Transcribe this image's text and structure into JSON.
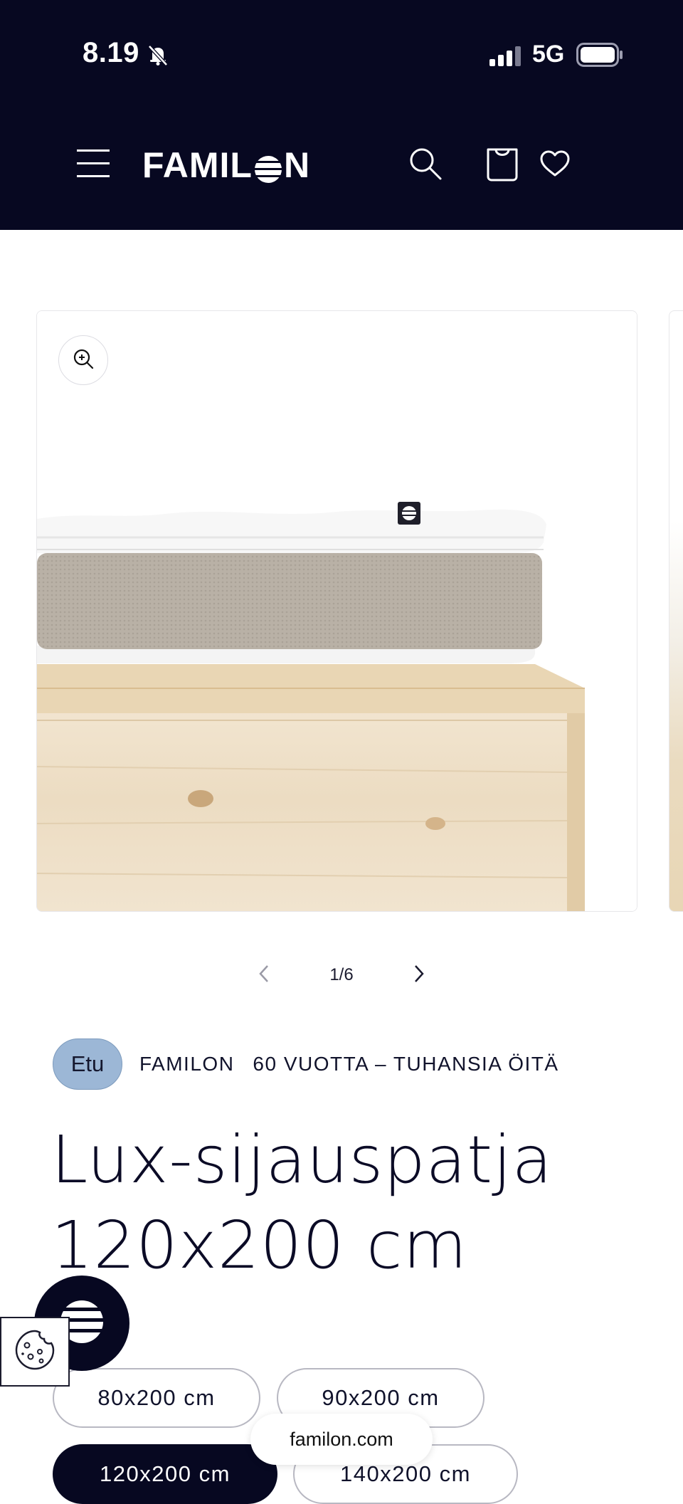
{
  "status_bar": {
    "time": "8.19",
    "network": "5G"
  },
  "header": {
    "logo_text_left": "FAMIL",
    "logo_text_right": "N",
    "icons": [
      "menu-icon",
      "search-icon",
      "cart-icon",
      "wishlist-icon"
    ]
  },
  "gallery": {
    "counter": "1/6",
    "zoom_icon": "zoom-in-icon"
  },
  "product": {
    "badge": "Etu",
    "vendor": "FAMILON",
    "tagline": "60 VUOTTA – TUHANSIA ÖITÄ",
    "title_line1": "Lux-sijauspatja",
    "title_line2": "120x200 cm",
    "sizes": [
      {
        "label": "80x200 cm",
        "selected": false
      },
      {
        "label": "90x200 cm",
        "selected": false
      },
      {
        "label": "120x200 cm",
        "selected": true
      },
      {
        "label": "140x200 cm",
        "selected": false
      }
    ]
  },
  "browser": {
    "url": "familon.com"
  },
  "colors": {
    "header_bg": "#070821",
    "badge_bg": "#9cb7d6",
    "selected_option_bg": "#070821"
  }
}
